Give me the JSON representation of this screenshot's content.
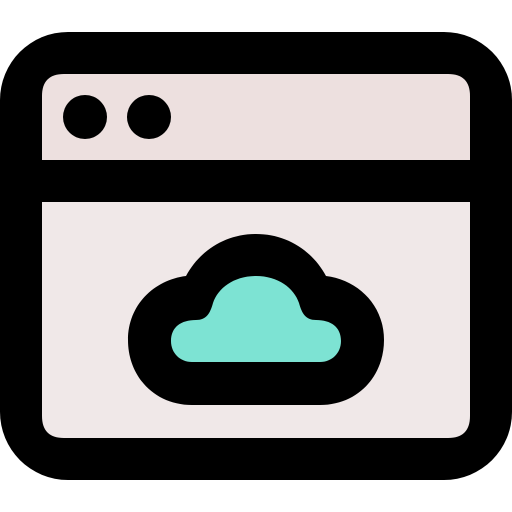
{
  "icon": {
    "name": "cloud-browser-window-icon",
    "colors": {
      "outline": "#000000",
      "title_bar_fill": "#ede0df",
      "window_body_fill": "#f0e8e8",
      "cloud_fill": "#7de3d3",
      "background": "#ffffff"
    },
    "parts": [
      "browser-window",
      "title-bar",
      "window-control-dots",
      "cloud-icon"
    ]
  }
}
